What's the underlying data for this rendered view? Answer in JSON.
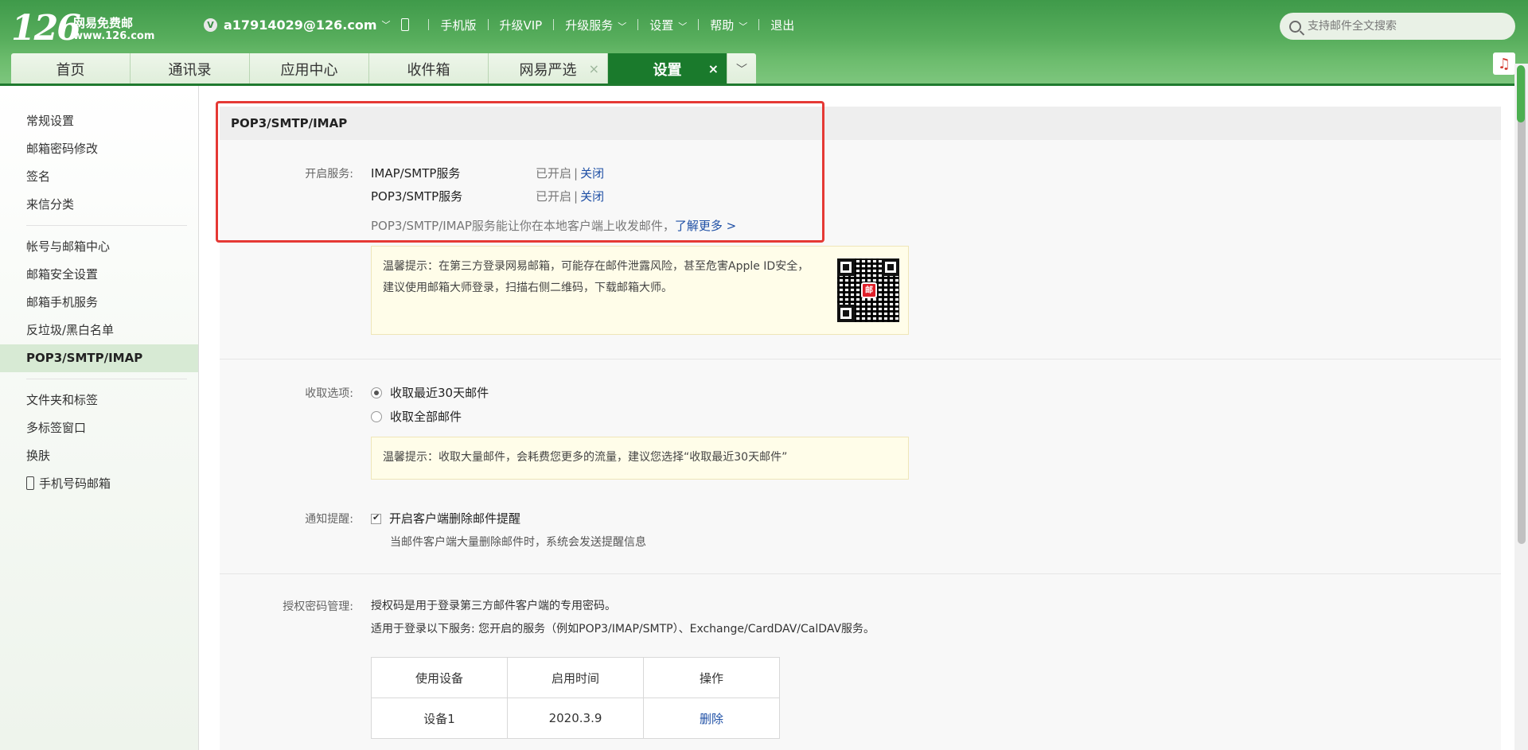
{
  "header": {
    "logo_number": "126",
    "logo_name": "网易免费邮",
    "logo_url": "www.126.com",
    "vip_badge": "V",
    "account": "a17914029@126.com",
    "nav": [
      "手机版",
      "升级VIP",
      "升级服务",
      "设置",
      "帮助",
      "退出"
    ],
    "search_placeholder": "支持邮件全文搜索"
  },
  "tabs": [
    {
      "label": "首页"
    },
    {
      "label": "通讯录"
    },
    {
      "label": "应用中心"
    },
    {
      "label": "收件箱"
    },
    {
      "label": "网易严选",
      "closable": true
    },
    {
      "label": "设置",
      "closable": true,
      "active": true
    }
  ],
  "tab_close_glyph": "×",
  "sidebar": {
    "group1": [
      "常规设置",
      "邮箱密码修改",
      "签名",
      "来信分类"
    ],
    "group2": [
      "帐号与邮箱中心",
      "邮箱安全设置",
      "邮箱手机服务",
      "反垃圾/黑白名单",
      "POP3/SMTP/IMAP"
    ],
    "group3": [
      "文件夹和标签",
      "多标签窗口",
      "换肤",
      "手机号码邮箱"
    ]
  },
  "main": {
    "section_title": "POP3/SMTP/IMAP",
    "services_label": "开启服务:",
    "services": [
      {
        "name": "IMAP/SMTP服务",
        "status": "已开启",
        "action": "关闭"
      },
      {
        "name": "POP3/SMTP服务",
        "status": "已开启",
        "action": "关闭"
      }
    ],
    "services_desc": "POP3/SMTP/IMAP服务能让你在本地客户端上收发邮件，",
    "learn_more": "了解更多 >",
    "tip1": "温馨提示：在第三方登录网易邮箱，可能存在邮件泄露风险，甚至危害Apple ID安全，建议使用邮箱大师登录，扫描右侧二维码，下载邮箱大师。",
    "qr_logo": "邮",
    "fetch_label": "收取选项:",
    "fetch_options": [
      {
        "label": "收取最近30天邮件",
        "checked": true
      },
      {
        "label": "收取全部邮件",
        "checked": false
      }
    ],
    "tip2": "温馨提示：收取大量邮件，会耗费您更多的流量，建议您选择“收取最近30天邮件”",
    "notify_label": "通知提醒:",
    "notify_option": "开启客户端删除邮件提醒",
    "notify_checked": true,
    "notify_desc": "当邮件客户端大量删除邮件时，系统会发送提醒信息",
    "auth_label": "授权密码管理:",
    "auth_line1": "授权码是用于登录第三方邮件客户端的专用密码。",
    "auth_line2": "适用于登录以下服务: 您开启的服务（例如POP3/IMAP/SMTP）、Exchange/CardDAV/CalDAV服务。",
    "table_headers": [
      "使用设备",
      "启用时间",
      "操作"
    ],
    "table_rows": [
      {
        "device": "设备1",
        "time": "2020.3.9",
        "action": "删除"
      }
    ]
  },
  "colors": {
    "header_green": "#57ad5c",
    "active_tab": "#1a7a2c",
    "link_blue": "#1e4fa5",
    "highlight_red": "#e53935"
  }
}
